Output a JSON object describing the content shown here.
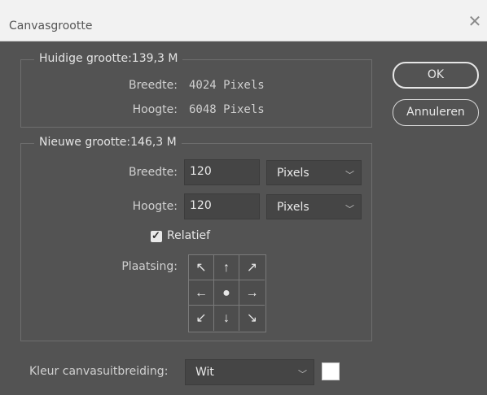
{
  "window": {
    "title": "Canvasgrootte",
    "close_icon": "close-icon"
  },
  "current": {
    "legend": "Huidige grootte:139,3 M",
    "width_label": "Breedte:",
    "width_value": "4024 Pixels",
    "height_label": "Hoogte:",
    "height_value": "6048 Pixels"
  },
  "new_size": {
    "legend": "Nieuwe grootte:146,3 M",
    "width_label": "Breedte:",
    "width_value": "120",
    "width_unit": "Pixels",
    "height_label": "Hoogte:",
    "height_value": "120",
    "height_unit": "Pixels",
    "relative_label": "Relatief",
    "relative_checked": true,
    "anchor_label": "Plaatsing:",
    "anchor_icons": [
      "arrow-up-left-icon",
      "arrow-up-icon",
      "arrow-up-right-icon",
      "arrow-left-icon",
      "anchor-center-icon",
      "arrow-right-icon",
      "arrow-down-left-icon",
      "arrow-down-icon",
      "arrow-down-right-icon"
    ]
  },
  "extension_color": {
    "label": "Kleur canvasuitbreiding:",
    "value": "Wit",
    "swatch_color": "#ffffff"
  },
  "buttons": {
    "ok": "OK",
    "cancel": "Annuleren"
  },
  "colors": {
    "background": "#535353",
    "titlebar": "#f2f2f2",
    "field": "#454545"
  }
}
